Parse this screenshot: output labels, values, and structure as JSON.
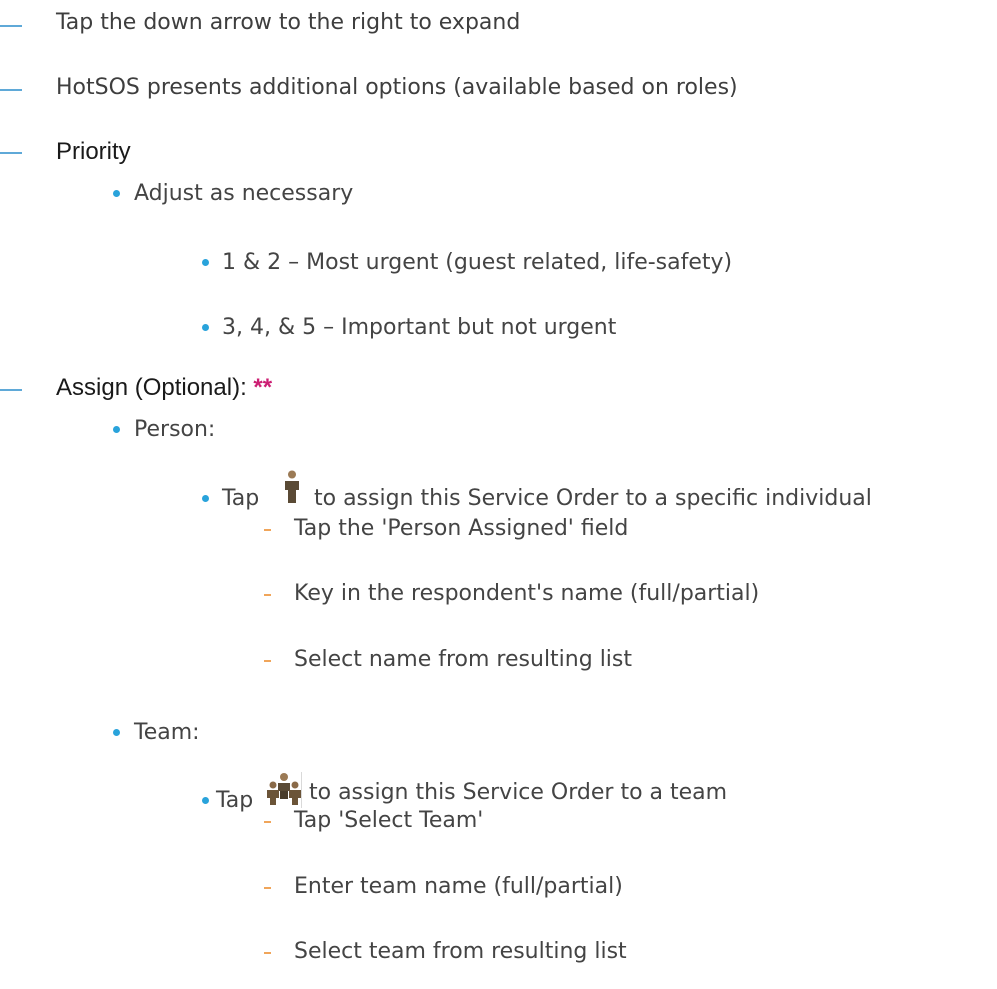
{
  "items": {
    "tap_arrow": "Tap the down arrow to the right to expand",
    "presents": "HotSOS presents additional options (available based on roles)",
    "priority": {
      "heading": "Priority",
      "adjust": "Adjust as necessary",
      "level_12": "1 & 2 – Most urgent (guest related, life-safety)",
      "level_345": "3, 4, & 5 – Important but not urgent"
    },
    "assign": {
      "heading": "Assign (Optional): ",
      "stars": "**",
      "person": {
        "label": "Person:",
        "tap": "Tap",
        "desc": "to assign this Service Order to a specific individual",
        "steps": [
          "Tap the 'Person Assigned' field",
          "Key in the respondent's name (full/partial)",
          "Select name from resulting list"
        ]
      },
      "team": {
        "label": "Team:",
        "tap": "Tap",
        "desc": "to assign this Service Order to a team",
        "steps": [
          "Tap 'Select Team'",
          "Enter team name (full/partial)",
          "Select team from resulting list"
        ]
      }
    }
  },
  "colors": {
    "dash": "#5fa9d8",
    "dot": "#29a3db",
    "hyphen": "#f0a55a",
    "stars": "#cc1f73"
  },
  "icons": {
    "person": "person-icon",
    "team": "team-icon"
  }
}
